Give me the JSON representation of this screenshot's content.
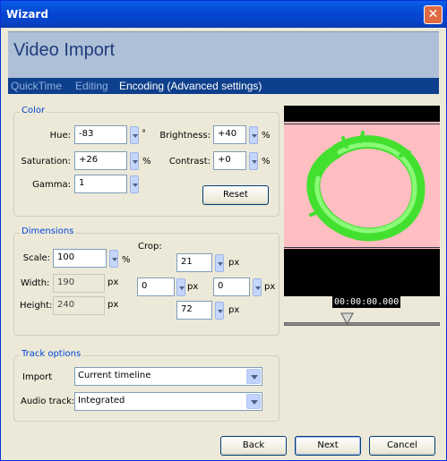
{
  "window": {
    "title": "Wizard",
    "close_glyph": "✕"
  },
  "header": {
    "title": "Video Import"
  },
  "tabs": [
    {
      "label": "QuickTime"
    },
    {
      "label": "Editing"
    },
    {
      "label": "Encoding (Advanced settings)",
      "active": true
    }
  ],
  "color": {
    "legend": "Color",
    "hue": {
      "label": "Hue:",
      "value": "-83",
      "unit": "°"
    },
    "saturation": {
      "label": "Saturation:",
      "value": "+26",
      "unit": "%"
    },
    "gamma": {
      "label": "Gamma:",
      "value": "1"
    },
    "brightness": {
      "label": "Brightness:",
      "value": "+40",
      "unit": "%"
    },
    "contrast": {
      "label": "Contrast:",
      "value": "+0",
      "unit": "%"
    },
    "reset_label": "Reset"
  },
  "dimensions": {
    "legend": "Dimensions",
    "scale": {
      "label": "Scale:",
      "value": "100",
      "unit": "%"
    },
    "width": {
      "label": "Width:",
      "value": "190",
      "unit": "px"
    },
    "height": {
      "label": "Height:",
      "value": "240",
      "unit": "px"
    },
    "crop": {
      "label": "Crop:",
      "top": {
        "value": "21",
        "unit": "px"
      },
      "left": {
        "value": "0",
        "unit": "px"
      },
      "right": {
        "value": "0",
        "unit": "px"
      },
      "bottom": {
        "value": "72",
        "unit": "px"
      }
    }
  },
  "track": {
    "legend": "Track options",
    "import": {
      "label": "Import",
      "value": "Current timeline"
    },
    "audio": {
      "label": "Audio track:",
      "value": "Integrated"
    }
  },
  "preview": {
    "timecode": "00:00:00.000",
    "background": "#ffbec1",
    "accent": "#44e030"
  },
  "buttons": {
    "back": "Back",
    "next": "Next",
    "cancel": "Cancel"
  }
}
